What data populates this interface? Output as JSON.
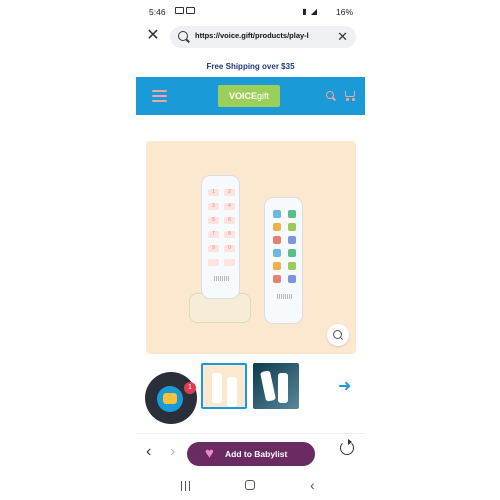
{
  "status_bar": {
    "time": "5:46",
    "battery": "16%"
  },
  "browser": {
    "url": "https://voice.gift/products/play-l",
    "cta_label": "Add to Babylist"
  },
  "banner": {
    "text": "Free Shipping over $35"
  },
  "header": {
    "logo_main": "VOICE",
    "logo_sub": "gift"
  },
  "product": {
    "number_keys": [
      "1",
      "2",
      "3",
      "4",
      "5",
      "6",
      "7",
      "8",
      "9",
      "0"
    ],
    "icon_colors": [
      "#6bb7e6",
      "#5bbd8c",
      "#f2b04a",
      "#9aca5a",
      "#e98074",
      "#7c95e0"
    ]
  },
  "chat": {
    "badge_count": "1"
  },
  "colors": {
    "brand_blue": "#1a9ad6",
    "cta_purple": "#6a2a62",
    "logo_green": "#9ccf59"
  }
}
